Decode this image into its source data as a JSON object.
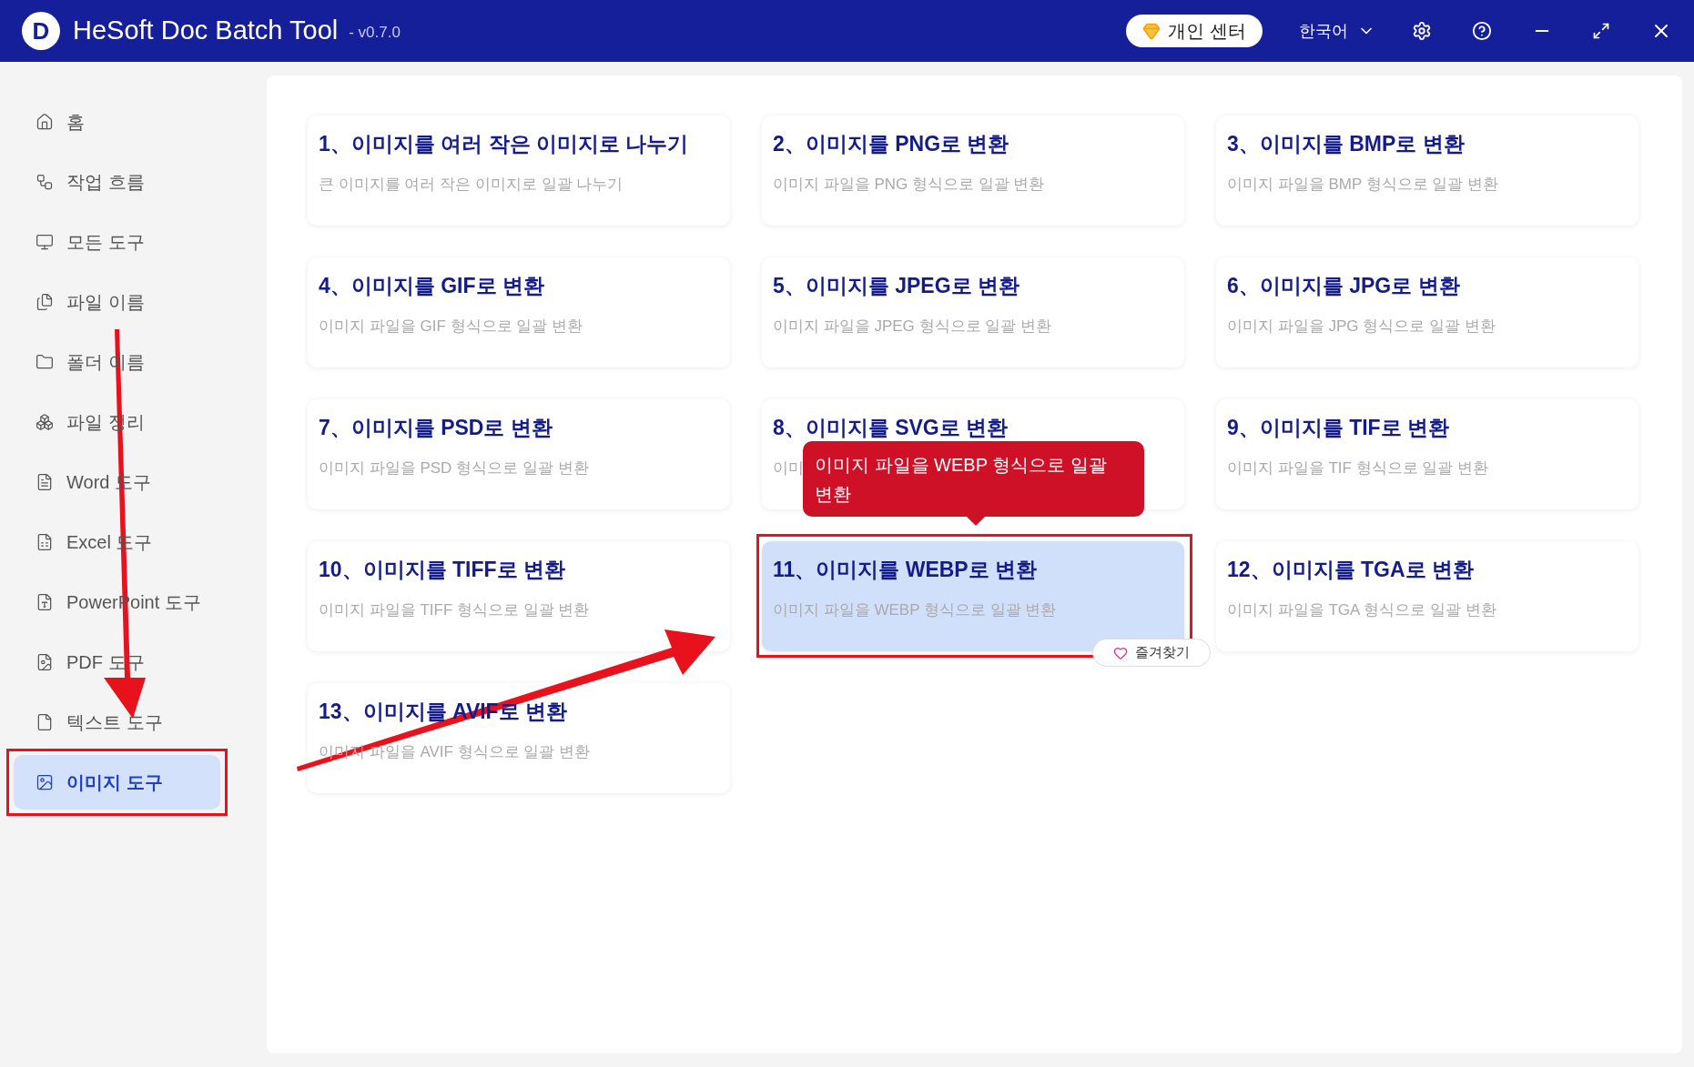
{
  "window": {
    "logo_letter": "D",
    "title": "HeSoft Doc Batch Tool",
    "version": "- v0.7.0"
  },
  "header": {
    "account_button": "개인 센터",
    "language": "한국어"
  },
  "sidebar": {
    "items": [
      {
        "label": "홈",
        "selected": false
      },
      {
        "label": "작업 흐름",
        "selected": false
      },
      {
        "label": "모든 도구",
        "selected": false
      },
      {
        "label": "파일 이름",
        "selected": false
      },
      {
        "label": "폴더 이름",
        "selected": false
      },
      {
        "label": "파일 정리",
        "selected": false
      },
      {
        "label": "Word 도구",
        "selected": false
      },
      {
        "label": "Excel 도구",
        "selected": false
      },
      {
        "label": "PowerPoint 도구",
        "selected": false
      },
      {
        "label": "PDF 도구",
        "selected": false
      },
      {
        "label": "텍스트 도구",
        "selected": false
      },
      {
        "label": "이미지 도구",
        "selected": true
      }
    ]
  },
  "cards": [
    {
      "title": "1、이미지를 여러 작은 이미지로 나누기",
      "description": "큰 이미지를 여러 작은 이미지로 일괄 나누기",
      "selected": false
    },
    {
      "title": "2、이미지를 PNG로 변환",
      "description": "이미지 파일을 PNG 형식으로 일괄 변환",
      "selected": false
    },
    {
      "title": "3、이미지를 BMP로 변환",
      "description": "이미지 파일을 BMP 형식으로 일괄 변환",
      "selected": false
    },
    {
      "title": "4、이미지를 GIF로 변환",
      "description": "이미지 파일을 GIF 형식으로 일괄 변환",
      "selected": false
    },
    {
      "title": "5、이미지를 JPEG로 변환",
      "description": "이미지 파일을 JPEG 형식으로 일괄 변환",
      "selected": false
    },
    {
      "title": "6、이미지를 JPG로 변환",
      "description": "이미지 파일을 JPG 형식으로 일괄 변환",
      "selected": false
    },
    {
      "title": "7、이미지를 PSD로 변환",
      "description": "이미지 파일을 PSD 형식으로 일괄 변환",
      "selected": false
    },
    {
      "title": "8、이미지를 SVG로 변환",
      "description": "이미",
      "selected": false
    },
    {
      "title": "9、이미지를 TIF로 변환",
      "description": "이미지 파일을 TIF 형식으로 일괄 변환",
      "selected": false
    },
    {
      "title": "10、이미지를 TIFF로 변환",
      "description": "이미지 파일을 TIFF 형식으로 일괄 변환",
      "selected": false
    },
    {
      "title": "11、이미지를 WEBP로 변환",
      "description": "이미지 파일을 WEBP 형식으로 일괄 변환",
      "selected": true
    },
    {
      "title": "12、이미지를 TGA로 변환",
      "description": "이미지 파일을 TGA 형식으로 일괄 변환",
      "selected": false
    },
    {
      "title": "13、이미지를 AVIF로 변환",
      "description": "이미지 파일을 AVIF 형식으로 일괄 변환",
      "selected": false
    }
  ],
  "tooltip": "이미지 파일을 WEBP 형식으로 일괄 변환",
  "favorite_button": "즐겨찾기"
}
